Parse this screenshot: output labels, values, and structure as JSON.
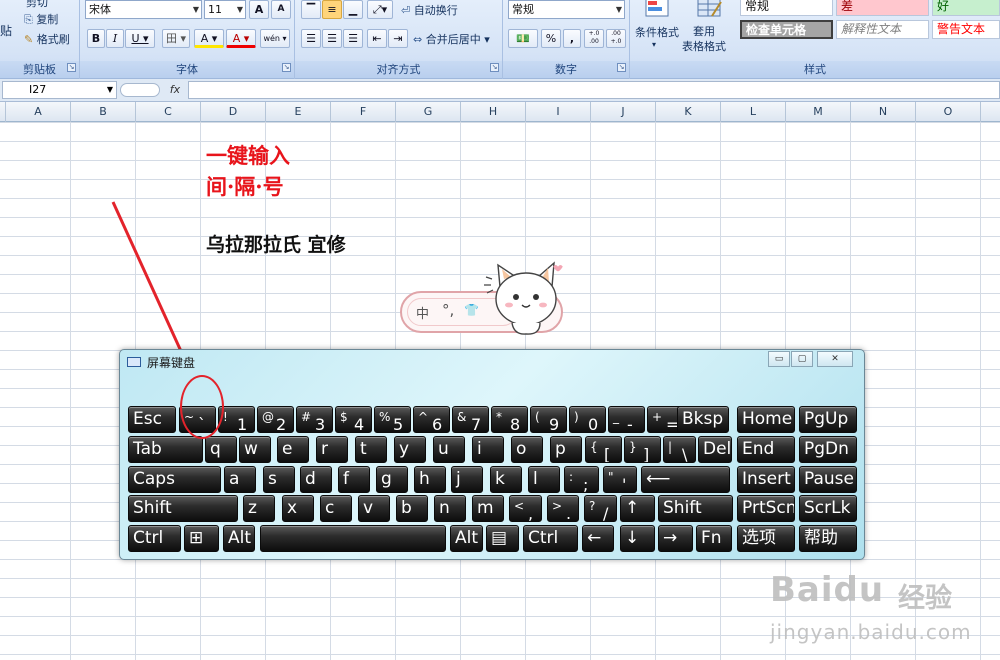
{
  "ribbon": {
    "clipboard": {
      "paste_partial": "贴",
      "cut_partial": "剪切",
      "copy": "复制",
      "format_painter": "格式刷",
      "label": "剪贴板"
    },
    "font": {
      "name": "宋体",
      "size": "11",
      "grow": "A",
      "shrink": "A",
      "bold": "B",
      "italic": "I",
      "underline": "U",
      "border": "田",
      "fill": "A",
      "color": "A",
      "phonetic": "wén",
      "label": "字体"
    },
    "alignment": {
      "wrap": "自动换行",
      "merge": "合并后居中",
      "label": "对齐方式"
    },
    "number": {
      "format": "常规",
      "percent": "%",
      "comma": ",",
      "inc_decimal": "+.0\n.00",
      "dec_decimal": ".00\n+.0",
      "label": "数字"
    },
    "styles": {
      "conditional": "条件格式",
      "table": "套用\n表格格式",
      "normal": "常规",
      "bad": "差",
      "good": "好",
      "check_cell": "检查单元格",
      "explanatory": "解释性文本",
      "warning": "警告文本",
      "label": "样式"
    }
  },
  "formula_bar": {
    "name_box": "I27",
    "fx": "fx",
    "content": ""
  },
  "columns": [
    "A",
    "B",
    "C",
    "D",
    "E",
    "F",
    "G",
    "H",
    "I",
    "J",
    "K",
    "L",
    "M",
    "N",
    "O"
  ],
  "sheet": {
    "line1": "一键输入",
    "line2": "间·隔·号",
    "name": "乌拉那拉氏 宜修"
  },
  "ime": {
    "mode": "中",
    "punct": "°,",
    "skin": "👕"
  },
  "osk": {
    "title": "屏幕键盘",
    "rows": [
      [
        {
          "m": "Esc"
        },
        {
          "s": "~",
          "m": "`"
        },
        {
          "s": "!",
          "m": "1"
        },
        {
          "s": "@",
          "m": "2"
        },
        {
          "s": "#",
          "m": "3"
        },
        {
          "s": "$",
          "m": "4"
        },
        {
          "s": "%",
          "m": "5"
        },
        {
          "s": "^",
          "m": "6"
        },
        {
          "s": "&",
          "m": "7"
        },
        {
          "s": "*",
          "m": "8"
        },
        {
          "s": "(",
          "m": "9"
        },
        {
          "s": ")",
          "m": "0"
        },
        {
          "s": "_",
          "m": "-"
        },
        {
          "s": "+",
          "m": "="
        },
        {
          "m": "Bksp"
        },
        {
          "m": "Home"
        },
        {
          "m": "PgUp"
        }
      ],
      [
        {
          "m": "Tab"
        },
        {
          "m": "q"
        },
        {
          "m": "w"
        },
        {
          "m": "e"
        },
        {
          "m": "r"
        },
        {
          "m": "t"
        },
        {
          "m": "y"
        },
        {
          "m": "u"
        },
        {
          "m": "i"
        },
        {
          "m": "o"
        },
        {
          "m": "p"
        },
        {
          "s": "{",
          "m": "["
        },
        {
          "s": "}",
          "m": "]"
        },
        {
          "s": "|",
          "m": "\\"
        },
        {
          "m": "Del"
        },
        {
          "m": "End"
        },
        {
          "m": "PgDn"
        }
      ],
      [
        {
          "m": "Caps"
        },
        {
          "m": "a"
        },
        {
          "m": "s"
        },
        {
          "m": "d"
        },
        {
          "m": "f"
        },
        {
          "m": "g"
        },
        {
          "m": "h"
        },
        {
          "m": "j"
        },
        {
          "m": "k"
        },
        {
          "m": "l"
        },
        {
          "s": ":",
          "m": ";"
        },
        {
          "s": "\"",
          "m": "'"
        },
        {
          "m": "⟵"
        },
        {
          "m": "Insert"
        },
        {
          "m": "Pause"
        }
      ],
      [
        {
          "m": "Shift"
        },
        {
          "m": "z"
        },
        {
          "m": "x"
        },
        {
          "m": "c"
        },
        {
          "m": "v"
        },
        {
          "m": "b"
        },
        {
          "m": "n"
        },
        {
          "m": "m"
        },
        {
          "s": "<",
          "m": ","
        },
        {
          "s": ">",
          "m": "."
        },
        {
          "s": "?",
          "m": "/"
        },
        {
          "m": "↑"
        },
        {
          "m": "Shift"
        },
        {
          "m": "PrtScn"
        },
        {
          "m": "ScrLk"
        }
      ],
      [
        {
          "m": "Ctrl"
        },
        {
          "m": "⊞"
        },
        {
          "m": "Alt"
        },
        {
          "m": ""
        },
        {
          "m": "Alt"
        },
        {
          "m": "▤"
        },
        {
          "m": "Ctrl"
        },
        {
          "m": "←"
        },
        {
          "m": "↓"
        },
        {
          "m": "→"
        },
        {
          "m": "Fn"
        },
        {
          "m": "选项"
        },
        {
          "m": "帮助"
        }
      ]
    ]
  },
  "watermark": {
    "brand": "Baidu",
    "cn": "经验",
    "url": "jingyan.baidu.com"
  }
}
